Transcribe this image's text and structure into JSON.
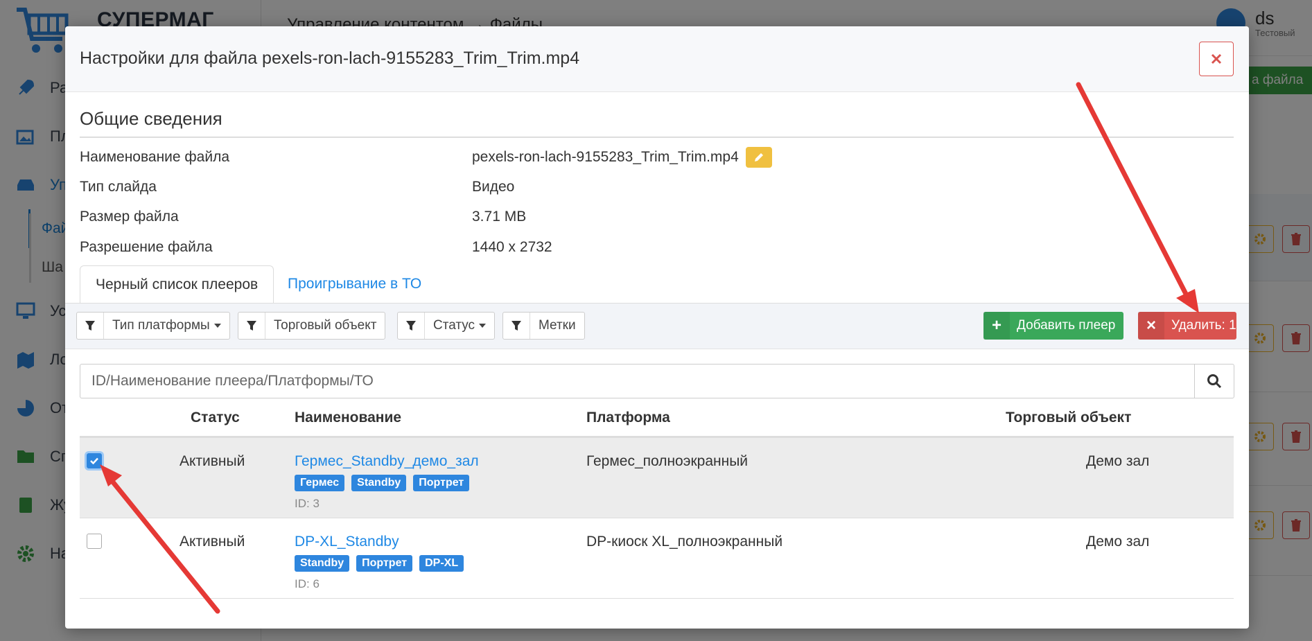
{
  "app": {
    "logo_text": "СУПЕРМАГ",
    "breadcrumb": "Управление контентом → Файлы",
    "user": {
      "name": "ds",
      "role": "Тестовый"
    },
    "add_file_label": "а файла",
    "menu": [
      {
        "label": "Рас",
        "icon": "rocket-icon"
      },
      {
        "label": "Пле",
        "icon": "images-icon"
      },
      {
        "label": "Упр",
        "icon": "hdd-icon"
      },
      {
        "label": "Уст",
        "icon": "monitor-icon"
      },
      {
        "label": "Лок",
        "icon": "map-icon"
      },
      {
        "label": "Отч",
        "icon": "pie-chart-icon"
      },
      {
        "label": "Спр",
        "icon": "folder-icon"
      },
      {
        "label": "Жу",
        "icon": "book-icon"
      },
      {
        "label": "Нас",
        "icon": "gear-icon"
      }
    ],
    "submenu": [
      "Фай",
      "Ша"
    ]
  },
  "modal": {
    "title": "Настройки для файла pexels-ron-lach-9155283_Trim_Trim.mp4",
    "section_title": "Общие сведения",
    "info": [
      {
        "label": "Наименование файла",
        "value": "pexels-ron-lach-9155283_Trim_Trim.mp4"
      },
      {
        "label": "Тип слайда",
        "value": "Видео"
      },
      {
        "label": "Размер файла",
        "value": "3.71 MB"
      },
      {
        "label": "Разрешение файла",
        "value": "1440 x 2732"
      }
    ],
    "tabs": [
      "Черный список плееров",
      "Проигрывание в ТО"
    ],
    "filters": [
      "Тип платформы",
      "Торговый объект",
      "Статус",
      "Метки"
    ],
    "add_player_label": "Добавить плеер",
    "delete_label": "Удалить: 1",
    "search_placeholder": "ID/Наименование плеера/Платформы/ТО",
    "table": {
      "headers": [
        "Статус",
        "Наименование",
        "Платформа",
        "Торговый объект"
      ],
      "rows": [
        {
          "checked": true,
          "status": "Активный",
          "name": "Гермес_Standby_демо_зал",
          "tags": [
            "Гермес",
            "Standby",
            "Портрет"
          ],
          "id": "ID: 3",
          "platform": "Гермес_полноэкранный",
          "store": "Демо зал"
        },
        {
          "checked": false,
          "status": "Активный",
          "name": "DP-XL_Standby",
          "tags": [
            "Standby",
            "Портрет",
            "DP-XL"
          ],
          "id": "ID: 6",
          "platform": "DP-киоск XL_полноэкранный",
          "store": "Демо зал"
        }
      ]
    }
  },
  "colors": {
    "accent_blue": "#1e88e5",
    "green": "#3aa85a",
    "red": "#d9534f",
    "edit_yellow": "#f0c040",
    "annotation_arrow": "#e53935"
  }
}
